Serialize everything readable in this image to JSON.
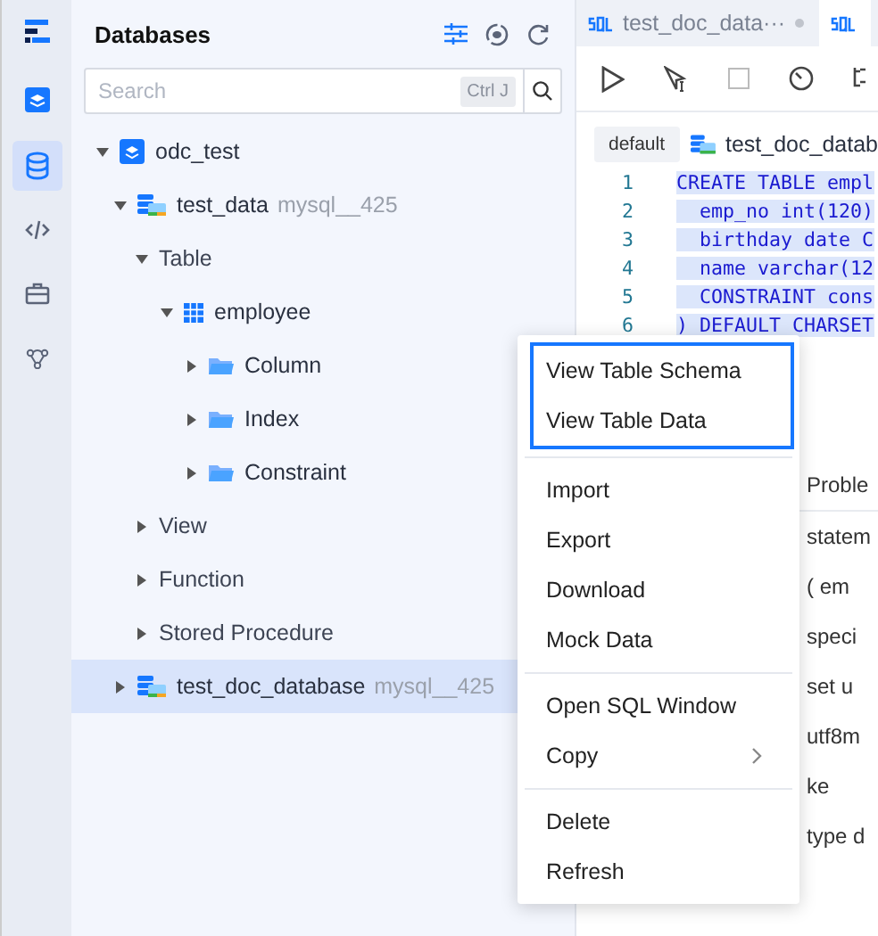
{
  "sidebar": {
    "title": "Databases",
    "search": {
      "placeholder": "Search",
      "shortcut": "Ctrl J"
    },
    "tree": [
      {
        "kind": "group",
        "label": "odc_test",
        "expanded": true,
        "selected": false,
        "children": [
          {
            "kind": "connection",
            "label": "test_data",
            "note": "mysql__425",
            "expanded": true,
            "selected": false,
            "children": [
              {
                "kind": "category",
                "label": "Table",
                "expanded": true,
                "selected": false,
                "children": [
                  {
                    "kind": "table",
                    "label": "employee",
                    "expanded": true,
                    "selected": false,
                    "children": [
                      {
                        "kind": "folder",
                        "label": "Column",
                        "expanded": false,
                        "selected": false
                      },
                      {
                        "kind": "folder",
                        "label": "Index",
                        "expanded": false,
                        "selected": false
                      },
                      {
                        "kind": "folder",
                        "label": "Constraint",
                        "expanded": false,
                        "selected": false
                      }
                    ]
                  }
                ]
              },
              {
                "kind": "category",
                "label": "View",
                "expanded": false,
                "selected": false
              },
              {
                "kind": "category",
                "label": "Function",
                "expanded": false,
                "selected": false
              },
              {
                "kind": "category",
                "label": "Stored Procedure",
                "expanded": false,
                "selected": false
              }
            ]
          },
          {
            "kind": "connection",
            "label": "test_doc_database",
            "note": "mysql__425",
            "expanded": false,
            "selected": true
          }
        ]
      }
    ]
  },
  "editor_tabs": [
    {
      "label": "test_doc_data···",
      "selected": false
    },
    {
      "selected": true
    }
  ],
  "editor": {
    "schema": "default",
    "database": "test_doc_datab",
    "lines": [
      {
        "number": "1",
        "code": "CREATE TABLE empl"
      },
      {
        "number": "2",
        "code": "  emp_no int(120)"
      },
      {
        "number": "3",
        "code": "  birthday date C"
      },
      {
        "number": "4",
        "code": "  name varchar(12"
      },
      {
        "number": "5",
        "code": "  CONSTRAINT cons"
      },
      {
        "number": "6",
        "code": ") DEFAULT CHARSET"
      }
    ]
  },
  "results": {
    "tab": "Proble",
    "lines": [
      "statem",
      "( em",
      "speci",
      "set u",
      "utf8m",
      "ke",
      "type d"
    ]
  },
  "context_menu": {
    "groups": [
      {
        "highlighted": true,
        "items": [
          {
            "label": "View Table Schema",
            "submenu": false
          },
          {
            "label": "View Table Data",
            "submenu": false
          }
        ]
      },
      {
        "highlighted": false,
        "items": [
          {
            "label": "Import",
            "submenu": false
          },
          {
            "label": "Export",
            "submenu": false
          },
          {
            "label": "Download",
            "submenu": false
          },
          {
            "label": "Mock Data",
            "submenu": false
          }
        ]
      },
      {
        "highlighted": false,
        "items": [
          {
            "label": "Open SQL Window",
            "submenu": false
          },
          {
            "label": "Copy",
            "submenu": true
          }
        ]
      },
      {
        "highlighted": false,
        "items": [
          {
            "label": "Delete",
            "submenu": false
          },
          {
            "label": "Refresh",
            "submenu": false
          }
        ]
      }
    ]
  }
}
